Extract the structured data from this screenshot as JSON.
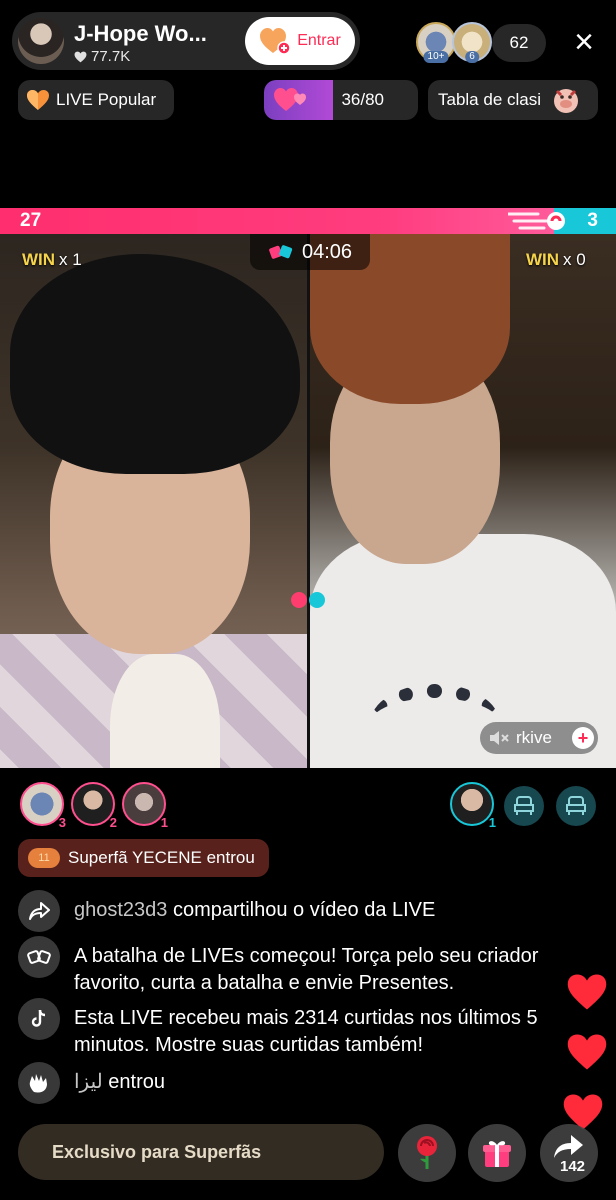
{
  "header": {
    "host_name": "J-Hope Wo...",
    "host_likes": "77.7K",
    "follow_label": "Entrar",
    "viewer_count": "62",
    "viewer_badge_1": "10+",
    "viewer_badge_2": "6",
    "close_icon": "×"
  },
  "tags": {
    "live_popular": "LIVE Popular",
    "progress_value": "36/80",
    "progress_fraction": 0.45,
    "ranking": "Tabla de clasi"
  },
  "battle": {
    "left_score": "27",
    "right_score": "3",
    "timer": "04:06",
    "left_win_label": "WIN",
    "left_win_count": "x 1",
    "right_win_label": "WIN",
    "right_win_count": "x 0",
    "opponent_name": "rkive"
  },
  "supporters": {
    "left": [
      "3",
      "2",
      "1"
    ],
    "right": [
      "1"
    ]
  },
  "chat": {
    "superfan_badge": "11",
    "superfan_text": "Superfã YECENE entrou",
    "lines": [
      {
        "user": "ghost23d3",
        "text": " compartilhou o vídeo da LIVE"
      },
      {
        "user": "",
        "text": "A batalha de LIVEs começou! Torça pelo seu criador favorito, curta a batalha e envie Presentes."
      },
      {
        "user": "",
        "text": "Esta LIVE recebeu mais 2314 curtidas nos últimos 5 minutos. Mostre suas curtidas também!"
      },
      {
        "user": "ليزا",
        "text": " entrou"
      }
    ]
  },
  "bottom": {
    "input_label": "Exclusivo para Superfãs",
    "share_count": "142"
  },
  "icons": [
    "heart-icon",
    "follow-icon",
    "close-icon",
    "fire-icon",
    "battle-icon",
    "share-icon",
    "tiktok-icon",
    "wave-icon",
    "rose-icon",
    "gift-icon",
    "seat-icon",
    "plus-icon",
    "mute-icon"
  ],
  "colors": {
    "accent": "#fe2c55",
    "team_left": "#ff3d7f",
    "team_right": "#18c8d8",
    "win": "#f5d34a"
  }
}
